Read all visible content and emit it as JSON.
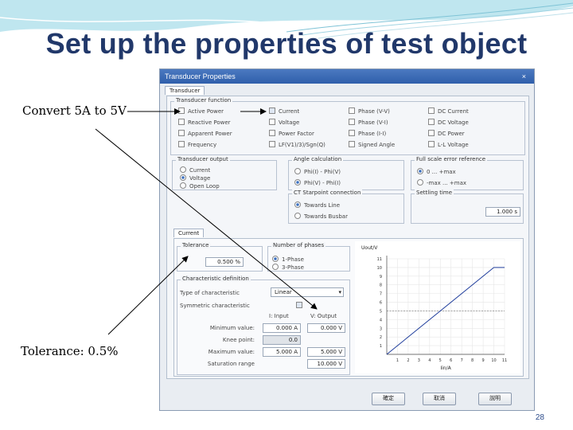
{
  "slide": {
    "title": "Set up the properties of test object",
    "annotation_top": "Convert 5A to 5V",
    "annotation_bottom": "Tolerance: 0.5%",
    "page_number": "28"
  },
  "dialog": {
    "title": "Transducer Properties",
    "close": "×",
    "tab_transducer": "Transducer",
    "function_group": "Transducer function",
    "functions": [
      {
        "label": "Active Power",
        "checked": false
      },
      {
        "label": "Current",
        "checked": true
      },
      {
        "label": "Phase (V-V)",
        "checked": false
      },
      {
        "label": "DC Current",
        "checked": false
      },
      {
        "label": "Reactive Power",
        "checked": false
      },
      {
        "label": "Voltage",
        "checked": false
      },
      {
        "label": "Phase (V-I)",
        "checked": false
      },
      {
        "label": "DC Voltage",
        "checked": false
      },
      {
        "label": "Apparent Power",
        "checked": false
      },
      {
        "label": "Power Factor",
        "checked": false
      },
      {
        "label": "Phase (I-I)",
        "checked": false
      },
      {
        "label": "DC Power",
        "checked": false
      },
      {
        "label": "Frequency",
        "checked": false
      },
      {
        "label": "LF(V1)/3)/Sgn(Q)",
        "checked": false
      },
      {
        "label": "Signed Angle",
        "checked": false
      },
      {
        "label": "L-L Voltage",
        "checked": false
      }
    ],
    "output_group": "Transducer output",
    "outputs": [
      {
        "label": "Current",
        "selected": false
      },
      {
        "label": "Voltage",
        "selected": true
      },
      {
        "label": "Open Loop",
        "selected": false
      }
    ],
    "angle_group": "Angle calculation",
    "angles": [
      {
        "label": "Phi(I) - Phi(V)",
        "selected": false
      },
      {
        "label": "Phi(V) - Phi(I)",
        "selected": true
      }
    ],
    "error_group": "Full scale error reference",
    "errors": [
      {
        "label": "0 ... +max",
        "selected": true
      },
      {
        "label": "-max ... +max",
        "selected": false
      }
    ],
    "ct_group": "CT Starpoint connection",
    "ct": [
      {
        "label": "Towards Line",
        "selected": true
      },
      {
        "label": "Towards Busbar",
        "selected": false
      }
    ],
    "settling_group": "Settling time",
    "settling_value": "1.000 s",
    "tab_current": "Current",
    "tolerance_group": "Tolerance",
    "tolerance_value": "0.500 %",
    "phases_group": "Number of phases",
    "phases": [
      {
        "label": "1-Phase",
        "selected": true
      },
      {
        "label": "3-Phase",
        "selected": false
      }
    ],
    "char_group": "Characteristic definition",
    "char_type_label": "Type of characteristic",
    "char_type_value": "Linear",
    "symmetric_label": "Symmetric characteristic",
    "col_input": "I: Input",
    "col_output": "V: Output",
    "rows": [
      {
        "label": "Minimum value:",
        "input": "0.000 A",
        "output": "0.000 V"
      },
      {
        "label": "Knee point:",
        "input": "0.0",
        "output": ""
      },
      {
        "label": "Maximum value:",
        "input": "5.000 A",
        "output": "5.000 V"
      },
      {
        "label": "Saturation range",
        "input": "",
        "output": "10.000 V"
      }
    ],
    "buttons": {
      "ok": "確定",
      "cancel": "取消",
      "help": "說明"
    }
  },
  "chart_data": {
    "type": "line",
    "ylabel": "Uout/V",
    "xlabel": "Iin/A",
    "xlim": [
      0,
      11
    ],
    "ylim": [
      0,
      11
    ],
    "xticks": [
      1,
      2,
      3,
      4,
      5,
      6,
      7,
      8,
      9,
      10,
      11
    ],
    "yticks": [
      1,
      2,
      3,
      4,
      5,
      6,
      7,
      8,
      9,
      10,
      11
    ],
    "series": [
      {
        "x": [
          0,
          10
        ],
        "y": [
          0,
          10
        ]
      },
      {
        "x": [
          10,
          11
        ],
        "y": [
          10,
          10
        ]
      }
    ],
    "dashed_level": 5
  },
  "colors": {
    "title": "#21386a",
    "titlebar": "#3a6ab8",
    "plot_line": "#1f3d9c",
    "arrow": "#000000"
  }
}
